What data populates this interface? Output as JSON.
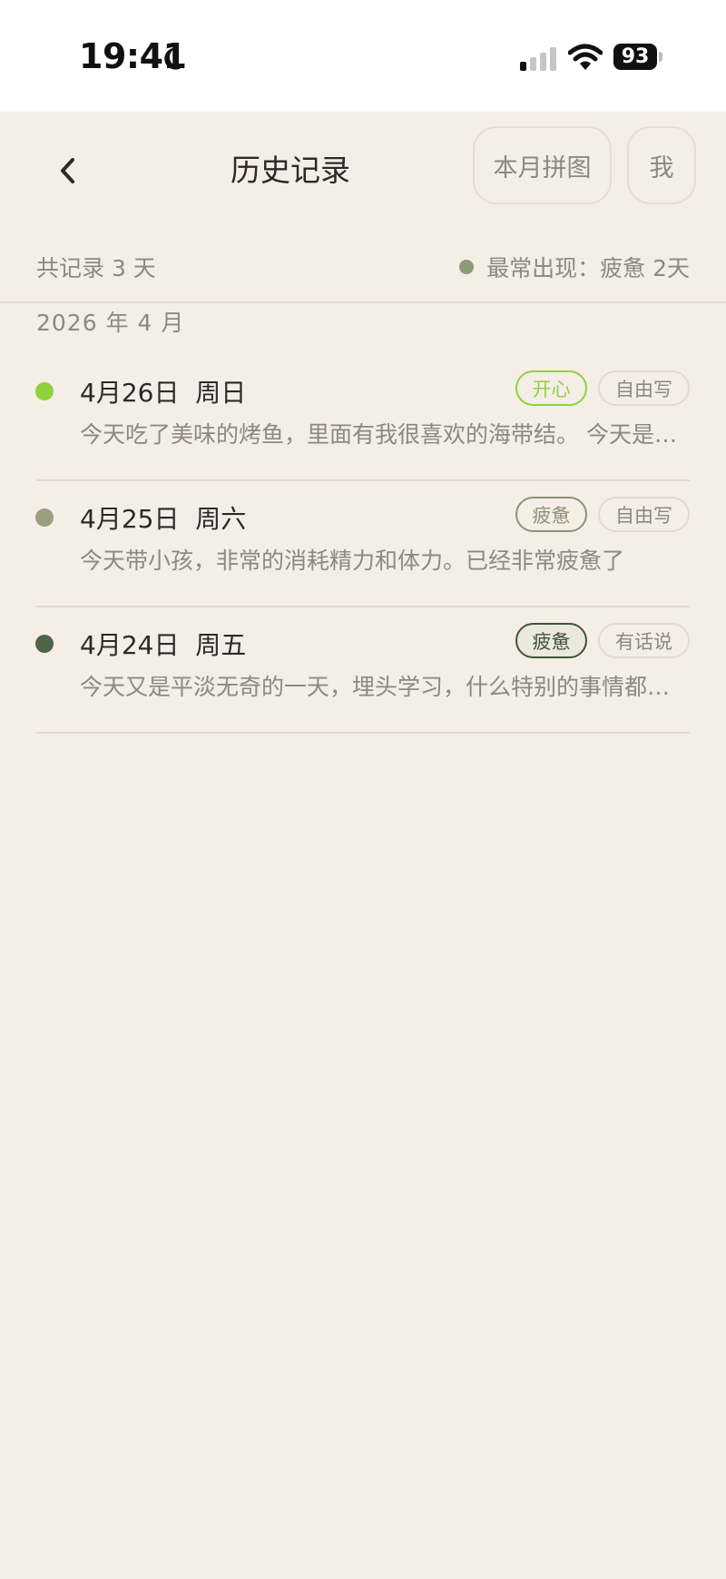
{
  "status_bar": {
    "time": "19:41",
    "battery": "93"
  },
  "header": {
    "title": "历史记录",
    "monthly_collage_label": "本月拼图",
    "me_label": "我"
  },
  "summary": {
    "count_text": "共记录 3 天",
    "frequent_mood_text": "最常出现：疲惫 2天",
    "frequent_mood_color": "#8e9a76"
  },
  "month_label": "2026 年 4 月",
  "entries": [
    {
      "date": "4月26日  周日",
      "preview": "今天吃了美味的烤鱼，里面有我很喜欢的海带结。 今天是我的生日，朋友们都来了",
      "mood": "开心",
      "type": "自由写",
      "dot_color": "#8fd13c",
      "tag_color": "#8fd13c",
      "tag_bg": "transparent"
    },
    {
      "date": "4月25日  周六",
      "preview": "今天带小孩，非常的消耗精力和体力。已经非常疲惫了",
      "mood": "疲惫",
      "type": "自由写",
      "dot_color": "#9aa07f",
      "tag_color": "#8c9474",
      "tag_bg": "transparent"
    },
    {
      "date": "4月24日  周五",
      "preview": "今天又是平淡无奇的一天，埋头学习，什么特别的事情都没有发生",
      "mood": "疲惫",
      "type": "有话说",
      "dot_color": "#4f6547",
      "tag_color": "#3f5438",
      "tag_bg": "#ebe8dc"
    }
  ]
}
